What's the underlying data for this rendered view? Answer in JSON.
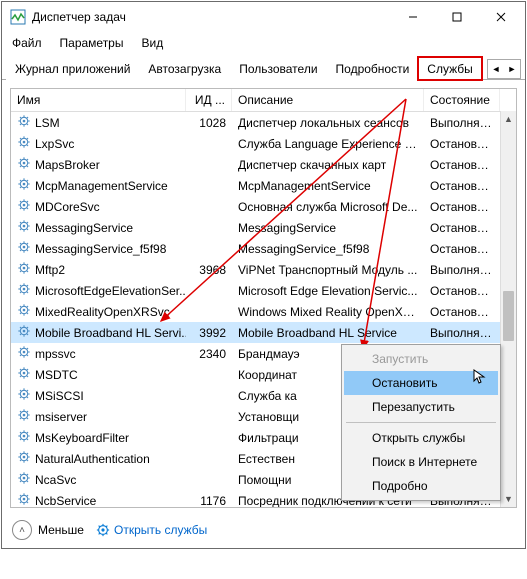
{
  "window": {
    "title": "Диспетчер задач"
  },
  "menu": {
    "file": "Файл",
    "options": "Параметры",
    "view": "Вид"
  },
  "tabs": {
    "t0": "Журнал приложений",
    "t1": "Автозагрузка",
    "t2": "Пользователи",
    "t3": "Подробности",
    "t4": "Службы"
  },
  "headers": {
    "name": "Имя",
    "pid": "ИД ...",
    "desc": "Описание",
    "state": "Состояние"
  },
  "rows": [
    {
      "name": "LSM",
      "pid": "1028",
      "desc": "Диспетчер локальных сеансов",
      "state": "Выполняется"
    },
    {
      "name": "LxpSvc",
      "pid": "",
      "desc": "Служба Language Experience S...",
      "state": "Остановлено"
    },
    {
      "name": "MapsBroker",
      "pid": "",
      "desc": "Диспетчер скачанных карт",
      "state": "Остановлено"
    },
    {
      "name": "McpManagementService",
      "pid": "",
      "desc": "McpManagementService",
      "state": "Остановлено"
    },
    {
      "name": "MDCoreSvc",
      "pid": "",
      "desc": "Основная служба Microsoft De...",
      "state": "Остановлено"
    },
    {
      "name": "MessagingService",
      "pid": "",
      "desc": "MessagingService",
      "state": "Остановлено"
    },
    {
      "name": "MessagingService_f5f98",
      "pid": "",
      "desc": "MessagingService_f5f98",
      "state": "Остановлено"
    },
    {
      "name": "Mftp2",
      "pid": "3968",
      "desc": "ViPNet Транспортный Модуль ...",
      "state": "Выполняется"
    },
    {
      "name": "MicrosoftEdgeElevationSer...",
      "pid": "",
      "desc": "Microsoft Edge Elevation Servic...",
      "state": "Остановлено"
    },
    {
      "name": "MixedRealityOpenXRSvc",
      "pid": "",
      "desc": "Windows Mixed Reality OpenXR...",
      "state": "Остановлено"
    },
    {
      "name": "Mobile Broadband HL Servi...",
      "pid": "3992",
      "desc": "Mobile Broadband HL Service",
      "state": "Выполняется"
    },
    {
      "name": "mpssvc",
      "pid": "2340",
      "desc": "Брандмауэ",
      "state": ""
    },
    {
      "name": "MSDTC",
      "pid": "",
      "desc": "Координат",
      "state": ""
    },
    {
      "name": "MSiSCSI",
      "pid": "",
      "desc": "Служба ка",
      "state": ""
    },
    {
      "name": "msiserver",
      "pid": "",
      "desc": "Установщи",
      "state": ""
    },
    {
      "name": "MsKeyboardFilter",
      "pid": "",
      "desc": "Фильтраци",
      "state": ""
    },
    {
      "name": "NaturalAuthentication",
      "pid": "",
      "desc": "Естествен",
      "state": ""
    },
    {
      "name": "NcaSvc",
      "pid": "",
      "desc": "Помощни",
      "state": ""
    },
    {
      "name": "NcbService",
      "pid": "1176",
      "desc": "Посредник подключений к сети",
      "state": "Выполняется"
    }
  ],
  "context_menu": {
    "start": "Запустить",
    "stop": "Остановить",
    "restart": "Перезапустить",
    "open": "Открыть службы",
    "search": "Поиск в Интернете",
    "details": "Подробно"
  },
  "footer": {
    "fewer": "Меньше",
    "open_services": "Открыть службы"
  }
}
